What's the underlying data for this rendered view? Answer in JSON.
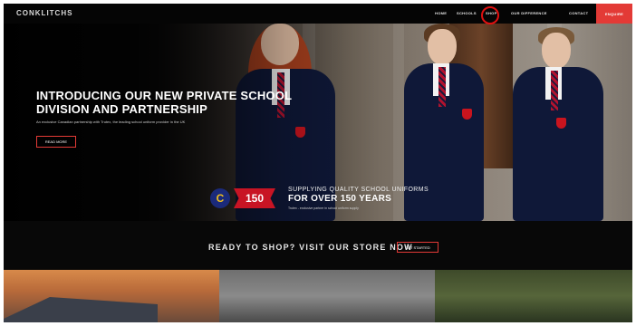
{
  "nav": {
    "logo": "CONKLITCHS",
    "items": [
      "HOME",
      "SCHOOLS",
      "SHOP",
      "OUR DIFFERENCE",
      "CONTACT"
    ],
    "cta": "ENQUIRE"
  },
  "hero": {
    "title": "INTRODUCING OUR NEW PRIVATE SCHOOL DIVISION AND PARTNERSHIP",
    "subtitle": "An exclusive Canadian partnership with Trutex, the leading school uniform provider in the UK",
    "button": "READ MORE",
    "banner": {
      "logo_letter": "C",
      "badge": "150",
      "line1": "SUPPLYING QUALITY SCHOOL UNIFORMS",
      "line2": "FOR OVER 150 YEARS",
      "line3": "Trutex - exclusive partner in school uniform supply"
    }
  },
  "shop_strip": {
    "text": "READY TO SHOP? VISIT OUR STORE NOW",
    "button": "GET STARTED"
  },
  "colors": {
    "accent": "#e33a36",
    "highlight_ring": "#e01010",
    "blazer": "#0f1838"
  }
}
